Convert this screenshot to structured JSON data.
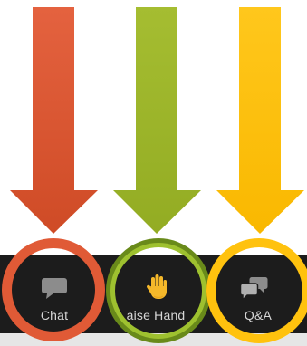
{
  "toolbar": {
    "background": "#1c1c1c",
    "buttons": [
      {
        "label": "Chat",
        "icon": "chat-bubble-icon",
        "highlight_color": "#e05a36"
      },
      {
        "label": "aise Hand",
        "icon": "raise-hand-icon",
        "highlight_color": "#8db22b"
      },
      {
        "label": "Q&A",
        "icon": "qa-bubbles-icon",
        "highlight_color": "#ffc20e"
      }
    ]
  },
  "annotations": {
    "arrows": [
      {
        "points_to": "Chat",
        "color": "#d9552e"
      },
      {
        "points_to": "Raise Hand",
        "color": "#9bb52c"
      },
      {
        "points_to": "Q&A",
        "color": "#fdc010"
      }
    ]
  }
}
